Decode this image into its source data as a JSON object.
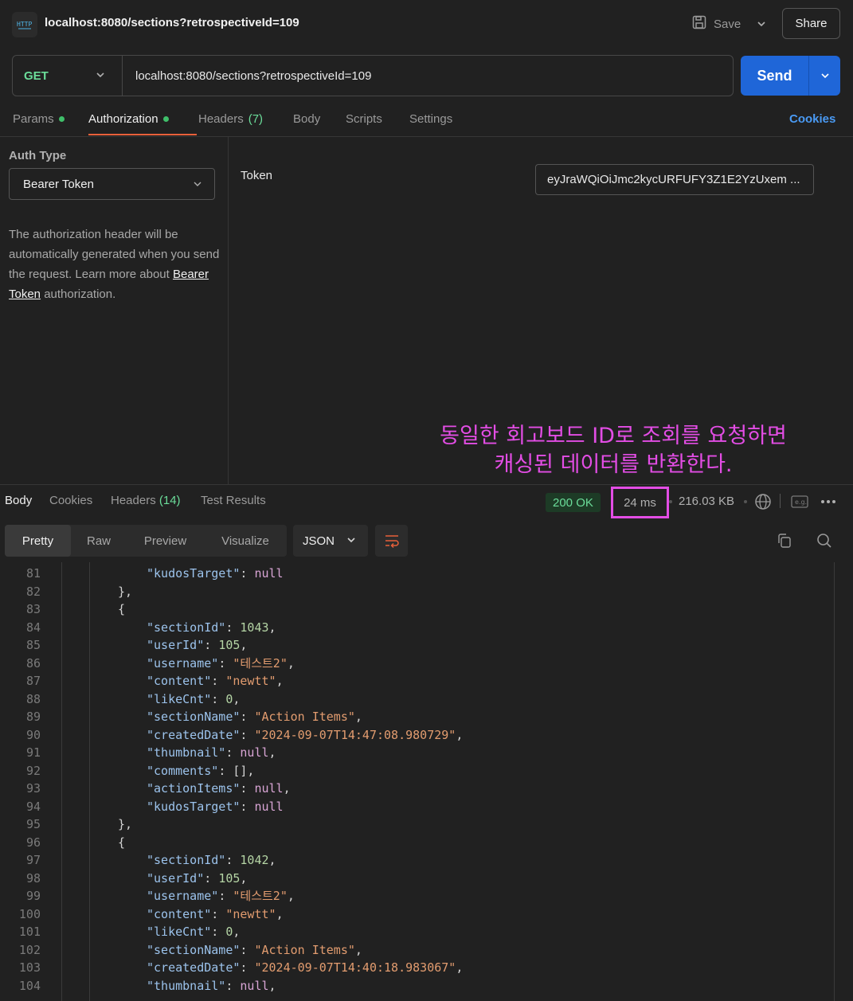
{
  "topbar": {
    "title": "localhost:8080/sections?retrospectiveId=109",
    "save_label": "Save",
    "share_label": "Share"
  },
  "request": {
    "method": "GET",
    "url": "localhost:8080/sections?retrospectiveId=109",
    "send_label": "Send"
  },
  "req_tabs": [
    {
      "label": "Params",
      "dot": true
    },
    {
      "label": "Authorization",
      "dot": true
    },
    {
      "label": "Headers",
      "count": "(7)"
    },
    {
      "label": "Body"
    },
    {
      "label": "Scripts"
    },
    {
      "label": "Settings"
    }
  ],
  "cookies_link": "Cookies",
  "auth": {
    "type_label": "Auth Type",
    "type_value": "Bearer Token",
    "desc_before": "The authorization header will be automatically generated when you send the request. Learn more about ",
    "desc_link": "Bearer Token",
    "desc_after": " authorization.",
    "token_label": "Token",
    "token_value": "eyJraWQiOiJmc2kycURFUFY3Z1E2YzUxem ..."
  },
  "annotation": {
    "line1": "동일한 회고보드 ID로 조회를 요청하면",
    "line2": "캐싱된 데이터를 반환한다."
  },
  "response": {
    "tabs": [
      {
        "label": "Body"
      },
      {
        "label": "Cookies"
      },
      {
        "label": "Headers",
        "count": "(14)"
      },
      {
        "label": "Test Results"
      }
    ],
    "status": "200 OK",
    "time": "24 ms",
    "size": "216.03 KB",
    "views": [
      "Pretty",
      "Raw",
      "Preview",
      "Visualize"
    ],
    "format": "JSON"
  },
  "code_lines": [
    {
      "n": "81",
      "indent": 3,
      "parts": [
        [
          "k",
          "\"kudosTarget\""
        ],
        [
          "p",
          ": "
        ],
        [
          "l",
          "null"
        ]
      ]
    },
    {
      "n": "82",
      "indent": 2,
      "parts": [
        [
          "p",
          "},"
        ]
      ]
    },
    {
      "n": "83",
      "indent": 2,
      "parts": [
        [
          "p",
          "{"
        ]
      ]
    },
    {
      "n": "84",
      "indent": 3,
      "parts": [
        [
          "k",
          "\"sectionId\""
        ],
        [
          "p",
          ": "
        ],
        [
          "n",
          "1043"
        ],
        [
          "p",
          ","
        ]
      ]
    },
    {
      "n": "85",
      "indent": 3,
      "parts": [
        [
          "k",
          "\"userId\""
        ],
        [
          "p",
          ": "
        ],
        [
          "n",
          "105"
        ],
        [
          "p",
          ","
        ]
      ]
    },
    {
      "n": "86",
      "indent": 3,
      "parts": [
        [
          "k",
          "\"username\""
        ],
        [
          "p",
          ": "
        ],
        [
          "s",
          "\"테스트2\""
        ],
        [
          "p",
          ","
        ]
      ]
    },
    {
      "n": "87",
      "indent": 3,
      "parts": [
        [
          "k",
          "\"content\""
        ],
        [
          "p",
          ": "
        ],
        [
          "s",
          "\"newtt\""
        ],
        [
          "p",
          ","
        ]
      ]
    },
    {
      "n": "88",
      "indent": 3,
      "parts": [
        [
          "k",
          "\"likeCnt\""
        ],
        [
          "p",
          ": "
        ],
        [
          "n",
          "0"
        ],
        [
          "p",
          ","
        ]
      ]
    },
    {
      "n": "89",
      "indent": 3,
      "parts": [
        [
          "k",
          "\"sectionName\""
        ],
        [
          "p",
          ": "
        ],
        [
          "s",
          "\"Action Items\""
        ],
        [
          "p",
          ","
        ]
      ]
    },
    {
      "n": "90",
      "indent": 3,
      "parts": [
        [
          "k",
          "\"createdDate\""
        ],
        [
          "p",
          ": "
        ],
        [
          "s",
          "\"2024-09-07T14:47:08.980729\""
        ],
        [
          "p",
          ","
        ]
      ]
    },
    {
      "n": "91",
      "indent": 3,
      "parts": [
        [
          "k",
          "\"thumbnail\""
        ],
        [
          "p",
          ": "
        ],
        [
          "l",
          "null"
        ],
        [
          "p",
          ","
        ]
      ]
    },
    {
      "n": "92",
      "indent": 3,
      "parts": [
        [
          "k",
          "\"comments\""
        ],
        [
          "p",
          ": [],"
        ]
      ]
    },
    {
      "n": "93",
      "indent": 3,
      "parts": [
        [
          "k",
          "\"actionItems\""
        ],
        [
          "p",
          ": "
        ],
        [
          "l",
          "null"
        ],
        [
          "p",
          ","
        ]
      ]
    },
    {
      "n": "94",
      "indent": 3,
      "parts": [
        [
          "k",
          "\"kudosTarget\""
        ],
        [
          "p",
          ": "
        ],
        [
          "l",
          "null"
        ]
      ]
    },
    {
      "n": "95",
      "indent": 2,
      "parts": [
        [
          "p",
          "},"
        ]
      ]
    },
    {
      "n": "96",
      "indent": 2,
      "parts": [
        [
          "p",
          "{"
        ]
      ]
    },
    {
      "n": "97",
      "indent": 3,
      "parts": [
        [
          "k",
          "\"sectionId\""
        ],
        [
          "p",
          ": "
        ],
        [
          "n",
          "1042"
        ],
        [
          "p",
          ","
        ]
      ]
    },
    {
      "n": "98",
      "indent": 3,
      "parts": [
        [
          "k",
          "\"userId\""
        ],
        [
          "p",
          ": "
        ],
        [
          "n",
          "105"
        ],
        [
          "p",
          ","
        ]
      ]
    },
    {
      "n": "99",
      "indent": 3,
      "parts": [
        [
          "k",
          "\"username\""
        ],
        [
          "p",
          ": "
        ],
        [
          "s",
          "\"테스트2\""
        ],
        [
          "p",
          ","
        ]
      ]
    },
    {
      "n": "100",
      "indent": 3,
      "parts": [
        [
          "k",
          "\"content\""
        ],
        [
          "p",
          ": "
        ],
        [
          "s",
          "\"newtt\""
        ],
        [
          "p",
          ","
        ]
      ]
    },
    {
      "n": "101",
      "indent": 3,
      "parts": [
        [
          "k",
          "\"likeCnt\""
        ],
        [
          "p",
          ": "
        ],
        [
          "n",
          "0"
        ],
        [
          "p",
          ","
        ]
      ]
    },
    {
      "n": "102",
      "indent": 3,
      "parts": [
        [
          "k",
          "\"sectionName\""
        ],
        [
          "p",
          ": "
        ],
        [
          "s",
          "\"Action Items\""
        ],
        [
          "p",
          ","
        ]
      ]
    },
    {
      "n": "103",
      "indent": 3,
      "parts": [
        [
          "k",
          "\"createdDate\""
        ],
        [
          "p",
          ": "
        ],
        [
          "s",
          "\"2024-09-07T14:40:18.983067\""
        ],
        [
          "p",
          ","
        ]
      ]
    },
    {
      "n": "104",
      "indent": 3,
      "parts": [
        [
          "k",
          "\"thumbnail\""
        ],
        [
          "p",
          ": "
        ],
        [
          "l",
          "null"
        ],
        [
          "p",
          ","
        ]
      ]
    }
  ],
  "colors": {
    "accent_blue": "#1f66d8",
    "method_green": "#6bdd9a",
    "annotation_magenta": "#e34de5",
    "active_tab_underline": "#e8603a"
  },
  "icons": [
    "http-icon",
    "save-icon",
    "chevron-down-icon",
    "globe-icon",
    "example-icon",
    "more-icon",
    "wrap-icon",
    "copy-icon",
    "search-icon"
  ]
}
